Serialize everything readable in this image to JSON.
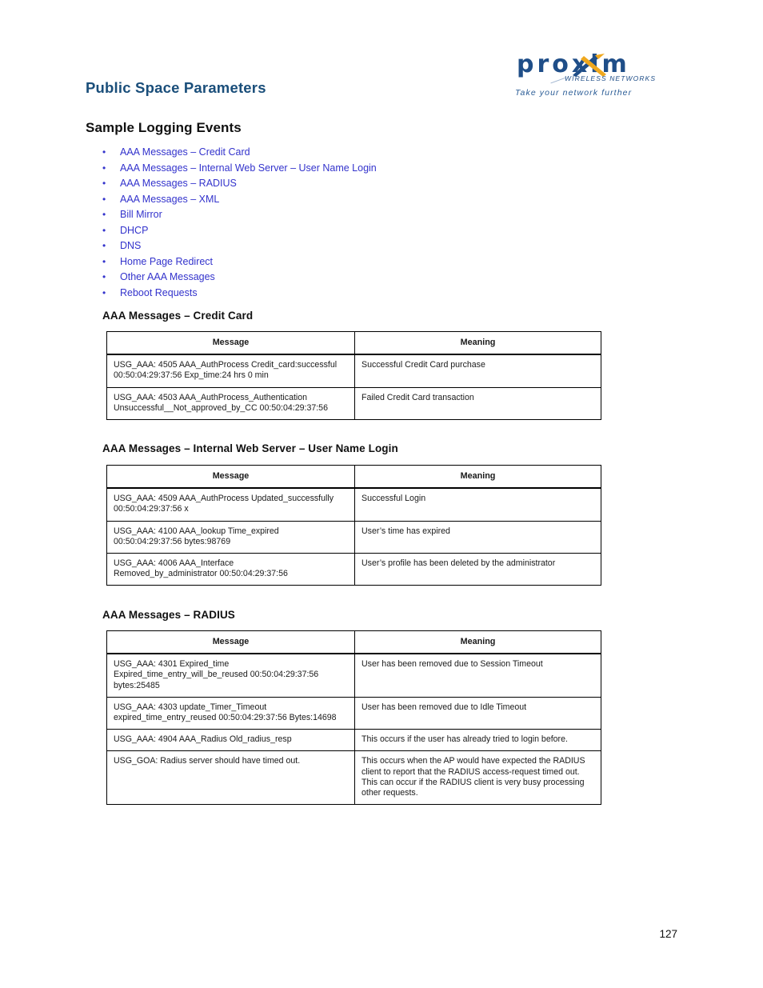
{
  "header": {
    "doc_title": "Public Space Parameters",
    "logo": {
      "wordmark": "proxim",
      "subtitle": "WIRELESS NETWORKS",
      "tagline": "Take your network further",
      "brand_blue": "#1F4E88",
      "brand_gold": "#F0A81E"
    }
  },
  "section": {
    "title": "Sample Logging Events"
  },
  "toc": {
    "bullet": "•",
    "items": [
      {
        "label": "AAA Messages – Credit Card"
      },
      {
        "label": "AAA Messages – Internal Web Server – User Name Login"
      },
      {
        "label": "AAA Messages – RADIUS"
      },
      {
        "label": "AAA Messages – XML"
      },
      {
        "label": "Bill Mirror"
      },
      {
        "label": "DHCP"
      },
      {
        "label": "DNS"
      },
      {
        "label": "Home Page Redirect"
      },
      {
        "label": "Other AAA Messages"
      },
      {
        "label": "Reboot Requests"
      }
    ]
  },
  "tables": [
    {
      "heading": "AAA Messages – Credit Card",
      "columns": [
        "Message",
        "Meaning"
      ],
      "rows": [
        [
          "USG_AAA: 4505 AAA_AuthProcess Credit_card:successful\n00:50:04:29:37:56 Exp_time:24 hrs 0 min",
          "Successful Credit Card purchase"
        ],
        [
          "USG_AAA: 4503 AAA_AuthProcess_Authentication\nUnsuccessful__Not_approved_by_CC 00:50:04:29:37:56",
          "Failed Credit Card transaction"
        ]
      ]
    },
    {
      "heading": "AAA Messages – Internal Web Server – User Name Login",
      "columns": [
        "Message",
        "Meaning"
      ],
      "rows": [
        [
          "USG_AAA: 4509 AAA_AuthProcess Updated_successfully\n00:50:04:29:37:56 x",
          "Successful Login"
        ],
        [
          "USG_AAA: 4100 AAA_lookup Time_expired\n00:50:04:29:37:56 bytes:98769",
          "User’s time has expired"
        ],
        [
          "USG_AAA: 4006 AAA_Interface\nRemoved_by_administrator 00:50:04:29:37:56",
          "User’s profile has been deleted by the administrator"
        ]
      ]
    },
    {
      "heading": "AAA Messages – RADIUS",
      "columns": [
        "Message",
        "Meaning"
      ],
      "rows": [
        [
          "USG_AAA: 4301 Expired_time\nExpired_time_entry_will_be_reused 00:50:04:29:37:56\nbytes:25485",
          "User has been removed due to Session Timeout"
        ],
        [
          " USG_AAA: 4303 update_Timer_Timeout\nexpired_time_entry_reused 00:50:04:29:37:56 Bytes:14698",
          "User has been removed due to Idle Timeout"
        ],
        [
          "USG_AAA: 4904 AAA_Radius Old_radius_resp",
          "This occurs if the user has already tried to login before."
        ],
        [
          " USG_GOA: Radius server should have timed out.",
          "This occurs when the AP would have expected the RADIUS client to report that the RADIUS access-request timed out. This can occur if the RADIUS client is very busy processing other requests."
        ]
      ]
    }
  ],
  "footer": {
    "page_number": "127"
  }
}
